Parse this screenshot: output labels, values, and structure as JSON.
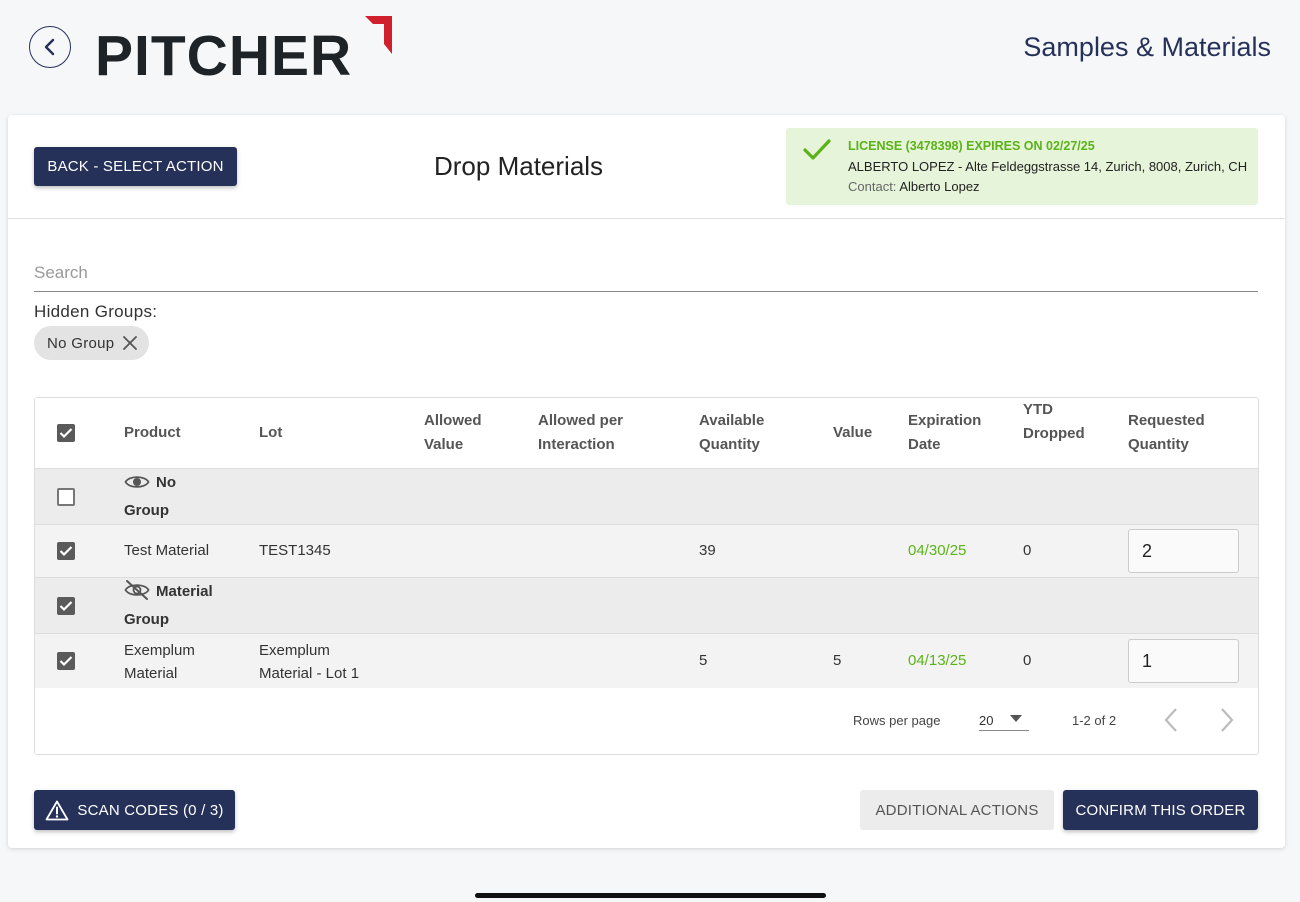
{
  "header": {
    "logo_text": "PITCHER",
    "app_title": "Samples & Materials"
  },
  "toolbar": {
    "back_label": "BACK - SELECT ACTION",
    "page_title": "Drop Materials"
  },
  "license": {
    "title": "LICENSE (3478398) EXPIRES ON 02/27/25",
    "address": "ALBERTO LOPEZ - Alte Feldeggstrasse 14, Zurich, 8008, Zurich, CH",
    "contact_label": "Contact:",
    "contact_name": "Alberto Lopez"
  },
  "search": {
    "placeholder": "Search",
    "value": ""
  },
  "hidden_groups": {
    "label": "Hidden Groups:",
    "chips": [
      "No Group"
    ]
  },
  "table": {
    "columns": {
      "product": "Product",
      "lot": "Lot",
      "allowed_value_1": "Allowed",
      "allowed_value_2": "Value",
      "allowed_per_1": "Allowed per",
      "allowed_per_2": "Interaction",
      "available_1": "Available",
      "available_2": "Quantity",
      "value": "Value",
      "expiration_1": "Expiration",
      "expiration_2": "Date",
      "ytd_1": "YTD",
      "ytd_2": "Dropped",
      "requested_1": "Requested",
      "requested_2": "Quantity"
    },
    "groups": [
      {
        "name_1": "No",
        "name_2": "Group",
        "visible": true,
        "checked": false,
        "rows": [
          {
            "checked": true,
            "product_1": "Test Material",
            "product_2": "",
            "lot_1": "TEST1345",
            "lot_2": "",
            "allowed_value": "",
            "allowed_per_interaction": "",
            "available_quantity": "39",
            "value": "",
            "expiration_date": "04/30/25",
            "ytd_dropped": "0",
            "requested_quantity": "2"
          }
        ]
      },
      {
        "name_1": "Material",
        "name_2": "Group",
        "visible": false,
        "checked": true,
        "rows": [
          {
            "checked": true,
            "product_1": "Exemplum",
            "product_2": "Material",
            "lot_1": "Exemplum",
            "lot_2": "Material - Lot 1",
            "allowed_value": "",
            "allowed_per_interaction": "",
            "available_quantity": "5",
            "value": "5",
            "expiration_date": "04/13/25",
            "ytd_dropped": "0",
            "requested_quantity": "1"
          }
        ]
      }
    ],
    "pagination": {
      "rows_per_page_label": "Rows per page",
      "rows_per_page": "20",
      "range": "1-2 of 2"
    }
  },
  "actions": {
    "scan_codes": "SCAN CODES (0 / 3)",
    "additional_actions": "ADDITIONAL ACTIONS",
    "confirm": "CONFIRM THIS ORDER"
  },
  "colors": {
    "primary": "#263159",
    "success": "#5bb318",
    "license_bg": "#e6f4d9",
    "logo_accent": "#d0202e"
  }
}
